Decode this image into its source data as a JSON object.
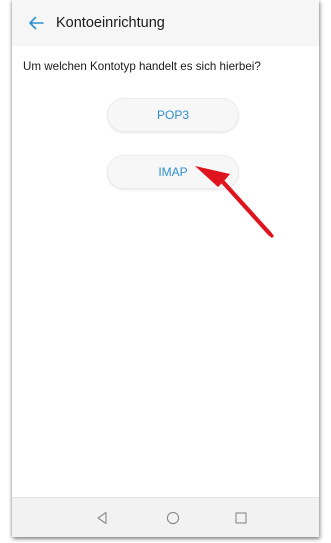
{
  "header": {
    "title": "Kontoeinrichtung",
    "back_icon": "back-arrow-icon"
  },
  "main": {
    "question": "Um welchen Kontotyp handelt es sich hierbei?",
    "options": [
      {
        "label": "POP3"
      },
      {
        "label": "IMAP"
      }
    ],
    "annotation_icon": "red-pointer-arrow"
  },
  "navbar": {
    "back_icon": "triangle-back-icon",
    "home_icon": "circle-home-icon",
    "recent_icon": "square-recents-icon"
  },
  "colors": {
    "accent": "#2f8fce",
    "annotation": "#e0141e",
    "appbar": "#f6f6f6",
    "navbar": "#f2f2f2"
  }
}
